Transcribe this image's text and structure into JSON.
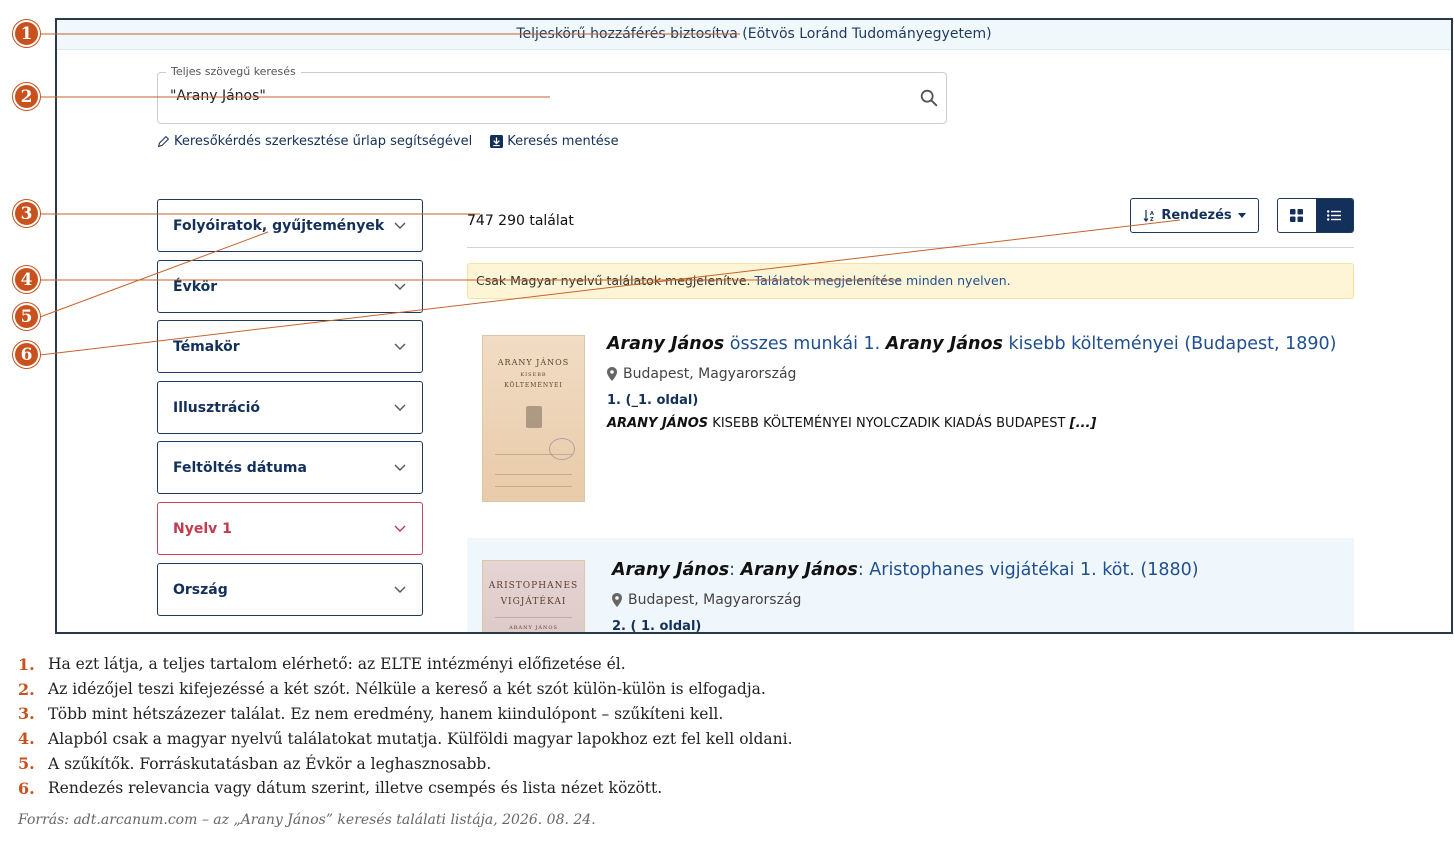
{
  "access_banner": "Teljeskörű hozzáférés biztosítva (Eötvös Loránd Tudományegyetem)",
  "search": {
    "legend": "Teljes szövegű keresés",
    "value": "\"Arany János\"",
    "icon": "search-icon"
  },
  "links": {
    "edit_query": "Keresőkérdés szerkesztése űrlap segítségével",
    "save_search": "Keresés mentése"
  },
  "facets": [
    {
      "label": "Folyóiratok, gyűjtemények",
      "active": false
    },
    {
      "label": "Évkör",
      "active": false
    },
    {
      "label": "Témakör",
      "active": false
    },
    {
      "label": "Illusztráció",
      "active": false
    },
    {
      "label": "Feltöltés dátuma",
      "active": false
    },
    {
      "label": "Nyelv 1",
      "active": true
    },
    {
      "label": "Ország",
      "active": false
    }
  ],
  "results": {
    "count": "747 290 találat",
    "sort_label": "Rendezés",
    "lang_notice": "Csak Magyar nyelvű találatok megjelenítve.",
    "lang_notice_link": "Találatok megjelenítése minden nyelven.",
    "items": [
      {
        "title_em": "Arany János",
        "title_mid": " összes munkái 1. ",
        "title_em2": "Arany János",
        "title_rest": " kisebb költeményei (Budapest, 1890)",
        "location": "Budapest, Magyarország",
        "page": "1. (_1. oldal)",
        "snippet_em": "ARANY JÁNOS",
        "snippet": " KISEBB KÖLTEMÉNYEI NYOLCZADIK KIADÁS BUDAPEST ",
        "snippet_more": "[...]",
        "thumb_lines": [
          "ARANY JÁNOS",
          "KISEBB",
          "KÖLTEMÉNYEI"
        ]
      },
      {
        "title_em": "Arany János",
        "title_mid": ": ",
        "title_em2": "Arany János",
        "title_rest": ": Aristophanes vigjátékai 1. köt. (1880)",
        "location": "Budapest, Magyarország",
        "page": "2. ( 1. oldal)",
        "thumb_lines": [
          "ARISTOPHANES",
          "VIGJÁTÉKAI",
          "ARANY JÁNOS"
        ]
      }
    ]
  },
  "callouts": [
    "1",
    "2",
    "3",
    "4",
    "5",
    "6"
  ],
  "notes": [
    {
      "num": "1.",
      "text": "Ha ezt látja, a teljes tartalom elérhető: az ELTE intézményi előfizetése él."
    },
    {
      "num": "2.",
      "text": "Az idézőjel teszi kifejezéssé a két szót. Nélküle a kereső a két szót külön-külön is elfogadja."
    },
    {
      "num": "3.",
      "text": "Több mint hétszázezer találat. Ez nem eredmény, hanem kiindulópont – szűkíteni kell."
    },
    {
      "num": "4.",
      "text": "Alapból csak a magyar nyelvű találatokat mutatja. Külföldi magyar lapokhoz ezt fel kell oldani."
    },
    {
      "num": "5.",
      "text": "A szűkítők. Forráskutatásban az Évkör a leghasznosabb."
    },
    {
      "num": "6.",
      "text": "Rendezés relevancia vagy dátum szerint, illetve csempés és lista nézet között."
    }
  ],
  "source": "Forrás: adt.arcanum.com – az „Arany János” keresés találati listája, 2026. 08. 24.",
  "colors": {
    "accent": "#c8511d",
    "navy": "#13305a",
    "active_facet": "#c23b4e"
  }
}
